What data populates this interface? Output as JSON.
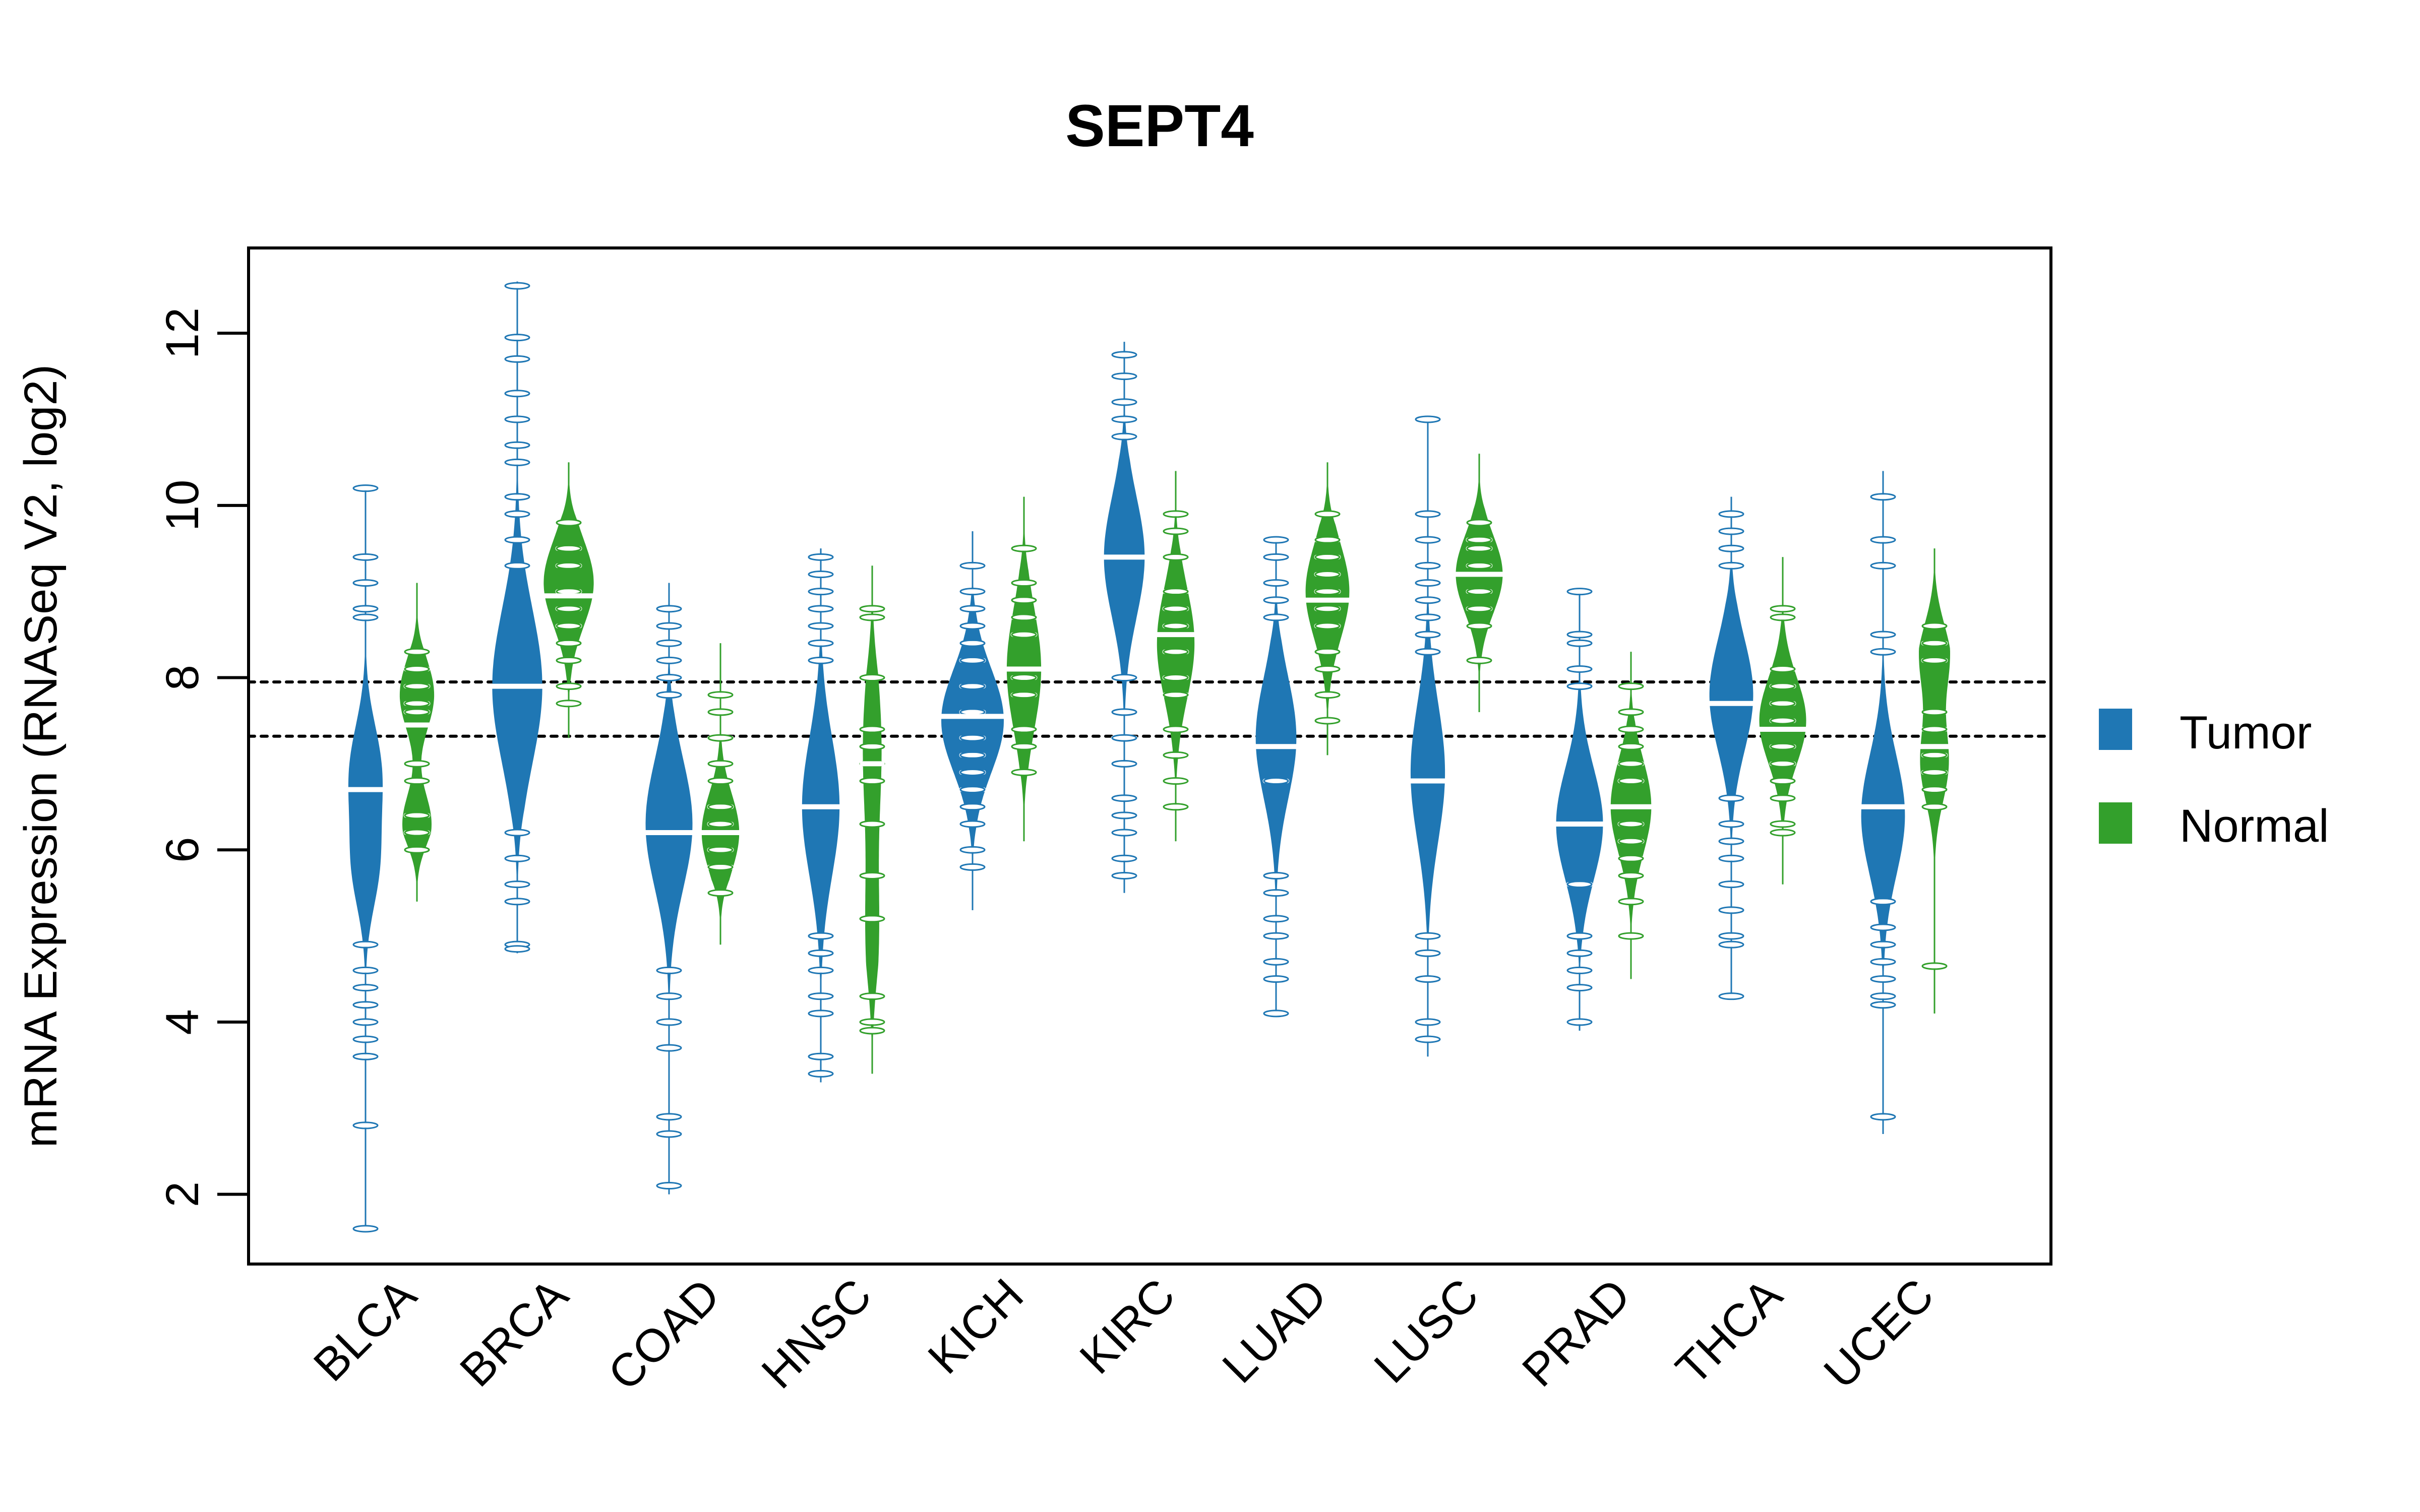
{
  "chart_data": {
    "type": "beanplot",
    "title": "SEPT4",
    "xlabel": "",
    "ylabel": "mRNA Expression (RNASeq V2, log2)",
    "ylim": [
      1.19,
      12.99
    ],
    "yticks": [
      2,
      4,
      6,
      8,
      10,
      12
    ],
    "grid": false,
    "legend": {
      "position": "right",
      "entries": [
        {
          "name": "Tumor",
          "color": "#1f77b4"
        },
        {
          "name": "Normal",
          "color": "#33a02c"
        }
      ]
    },
    "reference_lines": [
      {
        "y": 7.95,
        "style": "dotted",
        "color": "#000000"
      },
      {
        "y": 7.32,
        "style": "dotted",
        "color": "#000000"
      }
    ],
    "categories": [
      "BLCA",
      "BRCA",
      "COAD",
      "HNSC",
      "KICH",
      "KIRC",
      "LUAD",
      "LUSC",
      "PRAD",
      "THCA",
      "UCEC"
    ],
    "series": [
      {
        "name": "Tumor",
        "color": "#1f77b4",
        "beans": [
          {
            "category": "BLCA",
            "min": 1.6,
            "max": 10.2,
            "median": 6.7,
            "modes": [
              [
                6.9,
                0.55,
                1.0
              ],
              [
                5.8,
                0.5,
                0.8
              ]
            ],
            "width": 0.55,
            "beads": [
              10.2,
              9.4,
              9.1,
              8.8,
              8.7,
              4.9,
              4.6,
              4.4,
              4.2,
              4.0,
              3.8,
              3.6,
              2.8,
              1.6
            ]
          },
          {
            "category": "BRCA",
            "min": 4.8,
            "max": 12.6,
            "median": 7.9,
            "modes": [
              [
                7.9,
                0.9,
                1.0
              ]
            ],
            "width": 0.8,
            "beads": [
              12.55,
              11.95,
              11.7,
              11.3,
              11.0,
              10.7,
              10.5,
              10.1,
              9.9,
              9.6,
              9.3,
              6.2,
              5.9,
              5.6,
              5.4,
              4.9,
              4.85
            ]
          },
          {
            "category": "COAD",
            "min": 2.0,
            "max": 9.1,
            "median": 6.2,
            "modes": [
              [
                6.3,
                0.75,
                1.0
              ]
            ],
            "width": 0.75,
            "beads": [
              8.8,
              8.6,
              8.4,
              8.2,
              8.0,
              7.8,
              4.6,
              4.3,
              4.0,
              3.7,
              2.9,
              2.7,
              2.1
            ]
          },
          {
            "category": "HNSC",
            "min": 3.3,
            "max": 9.5,
            "median": 6.5,
            "modes": [
              [
                6.5,
                0.8,
                1.0
              ]
            ],
            "width": 0.6,
            "beads": [
              9.4,
              9.2,
              9.0,
              8.8,
              8.6,
              8.4,
              8.2,
              5.0,
              4.8,
              4.6,
              4.3,
              4.1,
              3.6,
              3.4
            ]
          },
          {
            "category": "KICH",
            "min": 5.3,
            "max": 9.7,
            "median": 7.55,
            "modes": [
              [
                7.5,
                0.6,
                1.0
              ]
            ],
            "width": 1.0,
            "beads": [
              9.3,
              9.0,
              8.8,
              8.6,
              8.4,
              8.2,
              7.9,
              7.6,
              7.3,
              7.1,
              6.9,
              6.7,
              6.5,
              6.3,
              6.0,
              5.8
            ]
          },
          {
            "category": "KIRC",
            "min": 5.5,
            "max": 11.9,
            "median": 9.4,
            "modes": [
              [
                9.4,
                0.7,
                1.0
              ]
            ],
            "width": 0.65,
            "beads": [
              11.75,
              11.5,
              11.2,
              11.0,
              10.8,
              8.0,
              7.6,
              7.3,
              7.0,
              6.6,
              6.4,
              6.2,
              5.9,
              5.7
            ]
          },
          {
            "category": "LUAD",
            "min": 4.1,
            "max": 9.6,
            "median": 7.2,
            "modes": [
              [
                7.3,
                0.7,
                1.0
              ]
            ],
            "width": 0.65,
            "beads": [
              9.6,
              9.4,
              9.1,
              8.9,
              8.7,
              6.8,
              5.7,
              5.5,
              5.2,
              5.0,
              4.7,
              4.5,
              4.1
            ]
          },
          {
            "category": "LUSC",
            "min": 3.6,
            "max": 11.0,
            "median": 6.8,
            "modes": [
              [
                6.9,
                0.8,
                1.0
              ]
            ],
            "width": 0.55,
            "beads": [
              11.0,
              9.9,
              9.6,
              9.3,
              9.1,
              8.9,
              8.7,
              8.5,
              8.3,
              5.0,
              4.8,
              4.5,
              4.0,
              3.8
            ]
          },
          {
            "category": "PRAD",
            "min": 3.9,
            "max": 9.0,
            "median": 6.3,
            "modes": [
              [
                6.3,
                0.65,
                1.0
              ]
            ],
            "width": 0.75,
            "beads": [
              9.0,
              8.5,
              8.4,
              8.1,
              7.9,
              5.6,
              5.0,
              4.8,
              4.6,
              4.4,
              4.0
            ]
          },
          {
            "category": "THCA",
            "min": 4.3,
            "max": 10.1,
            "median": 7.7,
            "modes": [
              [
                7.8,
                0.65,
                1.0
              ]
            ],
            "width": 0.7,
            "beads": [
              9.9,
              9.7,
              9.5,
              9.3,
              6.6,
              6.3,
              6.1,
              5.9,
              5.6,
              5.3,
              5.0,
              4.9,
              4.3
            ]
          },
          {
            "category": "UCEC",
            "min": 2.7,
            "max": 10.4,
            "median": 6.5,
            "modes": [
              [
                6.4,
                0.7,
                1.0
              ]
            ],
            "width": 0.7,
            "beads": [
              10.1,
              9.6,
              9.3,
              8.5,
              8.3,
              5.4,
              5.1,
              4.9,
              4.7,
              4.5,
              4.3,
              4.2,
              2.9
            ]
          }
        ]
      },
      {
        "name": "Normal",
        "color": "#33a02c",
        "beans": [
          {
            "category": "BLCA",
            "min": 5.4,
            "max": 9.1,
            "median": 7.45,
            "modes": [
              [
                7.8,
                0.4,
                1.0
              ],
              [
                6.3,
                0.35,
                0.85
              ]
            ],
            "width": 0.55,
            "beads": [
              8.3,
              8.1,
              7.9,
              7.7,
              7.6,
              7.0,
              6.8,
              6.4,
              6.2,
              6.0
            ]
          },
          {
            "category": "BRCA",
            "min": 7.3,
            "max": 10.5,
            "median": 8.95,
            "modes": [
              [
                9.1,
                0.5,
                1.0
              ]
            ],
            "width": 0.8,
            "beads": [
              9.8,
              9.5,
              9.3,
              9.0,
              8.8,
              8.6,
              8.4,
              8.2,
              7.9,
              7.7
            ]
          },
          {
            "category": "COAD",
            "min": 4.9,
            "max": 8.4,
            "median": 6.2,
            "modes": [
              [
                6.2,
                0.45,
                1.0
              ]
            ],
            "width": 0.6,
            "beads": [
              7.8,
              7.6,
              7.3,
              7.0,
              6.8,
              6.5,
              6.3,
              6.0,
              5.8,
              5.5
            ]
          },
          {
            "category": "HNSC",
            "min": 3.4,
            "max": 9.3,
            "median": 7.0,
            "modes": [
              [
                7.2,
                0.9,
                1.0
              ],
              [
                5.0,
                0.8,
                0.7
              ]
            ],
            "width": 0.3,
            "beads": [
              8.8,
              8.7,
              8.0,
              7.4,
              7.2,
              7.0,
              6.8,
              6.3,
              5.7,
              5.2,
              4.3,
              4.0,
              3.9
            ]
          },
          {
            "category": "KICH",
            "min": 6.1,
            "max": 10.1,
            "median": 8.1,
            "modes": [
              [
                8.1,
                0.7,
                1.0
              ]
            ],
            "width": 0.55,
            "beads": [
              9.5,
              9.1,
              8.9,
              8.7,
              8.5,
              8.0,
              7.8,
              7.4,
              7.2,
              6.9
            ]
          },
          {
            "category": "KIRC",
            "min": 6.1,
            "max": 10.4,
            "median": 8.5,
            "modes": [
              [
                8.4,
                0.65,
                1.0
              ]
            ],
            "width": 0.6,
            "beads": [
              9.9,
              9.7,
              9.4,
              9.0,
              8.8,
              8.6,
              8.3,
              8.0,
              7.8,
              7.4,
              7.1,
              6.8,
              6.5
            ]
          },
          {
            "category": "LUAD",
            "min": 7.1,
            "max": 10.5,
            "median": 8.9,
            "modes": [
              [
                9.0,
                0.55,
                1.0
              ]
            ],
            "width": 0.7,
            "beads": [
              9.9,
              9.6,
              9.4,
              9.2,
              9.0,
              8.8,
              8.6,
              8.3,
              8.1,
              7.8,
              7.5
            ]
          },
          {
            "category": "LUSC",
            "min": 7.6,
            "max": 10.6,
            "median": 9.2,
            "modes": [
              [
                9.2,
                0.45,
                1.0
              ]
            ],
            "width": 0.75,
            "beads": [
              9.8,
              9.6,
              9.5,
              9.3,
              9.0,
              8.8,
              8.6,
              8.2
            ]
          },
          {
            "category": "PRAD",
            "min": 4.5,
            "max": 8.3,
            "median": 6.5,
            "modes": [
              [
                6.5,
                0.55,
                1.0
              ]
            ],
            "width": 0.65,
            "beads": [
              7.9,
              7.6,
              7.4,
              7.2,
              7.0,
              6.8,
              6.3,
              6.1,
              5.9,
              5.7,
              5.4,
              5.0
            ]
          },
          {
            "category": "THCA",
            "min": 5.6,
            "max": 9.4,
            "median": 7.4,
            "modes": [
              [
                7.5,
                0.5,
                1.0
              ]
            ],
            "width": 0.75,
            "beads": [
              8.8,
              8.7,
              8.1,
              7.9,
              7.7,
              7.5,
              7.2,
              7.0,
              6.8,
              6.6,
              6.3,
              6.2
            ]
          },
          {
            "category": "UCEC",
            "min": 4.1,
            "max": 9.5,
            "median": 7.2,
            "modes": [
              [
                8.3,
                0.5,
                1.0
              ],
              [
                7.0,
                0.45,
                0.9
              ]
            ],
            "width": 0.5,
            "beads": [
              8.6,
              8.4,
              8.2,
              7.6,
              7.4,
              7.1,
              6.9,
              6.7,
              6.5,
              4.65
            ],
            "gap": [
              5.3,
              5.6
            ]
          }
        ]
      }
    ]
  }
}
